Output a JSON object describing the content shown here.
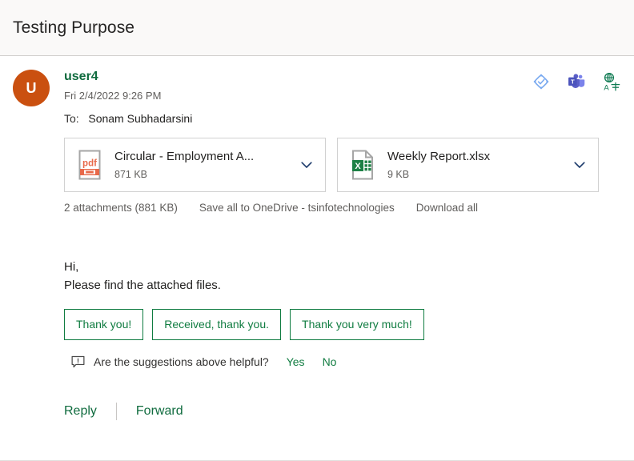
{
  "header": {
    "subject": "Testing Purpose"
  },
  "actions": [
    {
      "name": "protected-badge-icon",
      "label": "Protected"
    },
    {
      "name": "teams-icon",
      "label": "Microsoft Teams"
    },
    {
      "name": "translate-icon",
      "label": "Translate"
    }
  ],
  "message": {
    "avatar_initial": "U",
    "sender": "user4",
    "sent_date": "Fri 2/4/2022 9:26 PM",
    "to_label": "To:",
    "recipients": "Sonam Subhadarsini",
    "body_lines": [
      "Hi,",
      "Please find the attached files."
    ]
  },
  "attachments": {
    "items": [
      {
        "icon": "pdf-file-icon",
        "name": "Circular - Employment A...",
        "size": "871 KB",
        "chevron": "chevron-down-icon"
      },
      {
        "icon": "excel-file-icon",
        "name": "Weekly Report.xlsx",
        "size": "9 KB",
        "chevron": "chevron-down-icon"
      }
    ],
    "summary": "2 attachments (881 KB)",
    "save_all_label": "Save all to OneDrive - tsinfotechnologies",
    "download_all_label": "Download all"
  },
  "suggested_replies": {
    "chips": [
      "Thank you!",
      "Received, thank you.",
      "Thank you very much!"
    ],
    "feedback_prompt": "Are the suggestions above helpful?",
    "feedback_yes": "Yes",
    "feedback_no": "No"
  },
  "footer": {
    "reply_label": "Reply",
    "forward_label": "Forward"
  },
  "colors": {
    "accent_green": "#107c41",
    "sender_green": "#0f6b3e",
    "avatar_orange": "#ca5010",
    "header_bg": "#faf9f8",
    "border_gray": "#d2d0ce"
  }
}
